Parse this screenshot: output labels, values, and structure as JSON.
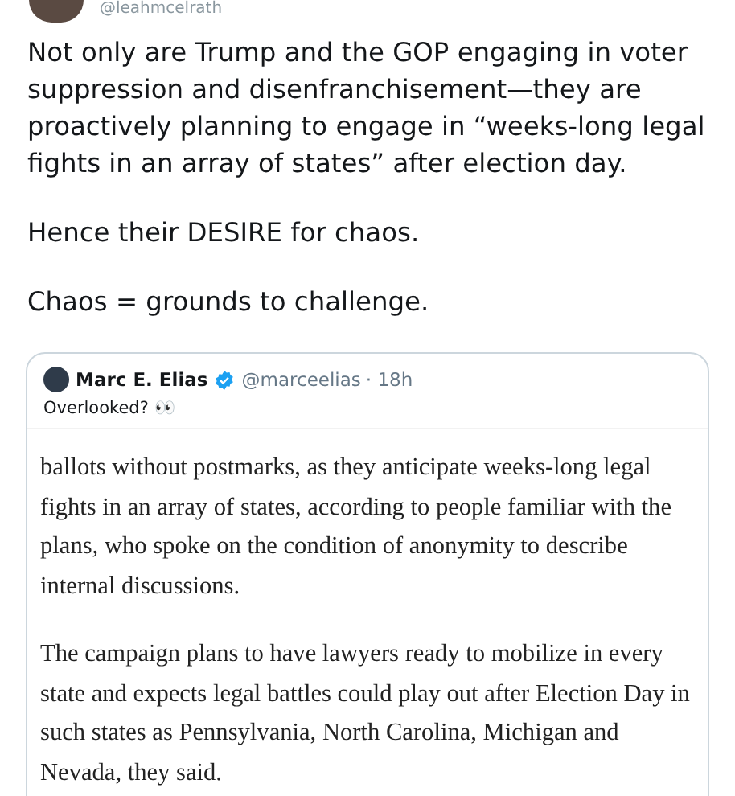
{
  "author": {
    "handle": "@leahmcelrath"
  },
  "tweet": {
    "paragraphs": [
      "Not only are Trump and the GOP engaging in voter suppression and disenfranchisement—they are proactively planning to engage in “weeks-long legal fights in an array of states” after election day.",
      "Hence their DESIRE for chaos.",
      "Chaos = grounds to challenge."
    ]
  },
  "quoted": {
    "name": "Marc E. Elias",
    "verified": true,
    "handle": "@marceelias",
    "time": "· 18h",
    "text": "Overlooked? 👀",
    "article": [
      "ballots without postmarks, as they anticipate weeks-long legal fights in an array of states, according to people familiar with the plans, who spoke on the condition of anonymity to describe internal discussions.",
      "The campaign plans to have lawyers ready to mobilize in every state and expects legal battles could play out after Election Day in such states as Pennsylvania, North Carolina, Michigan and Nevada, they said."
    ]
  }
}
